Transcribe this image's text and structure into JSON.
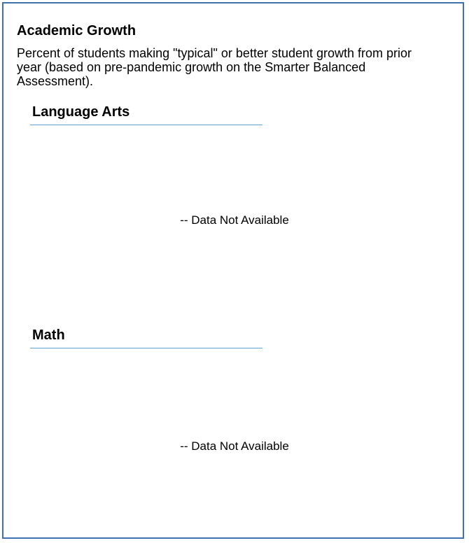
{
  "card": {
    "title": "Academic Growth",
    "description": "Percent of students making \"typical\" or better student growth from prior year (based on pre-pandemic growth on the Smarter Balanced Assessment)."
  },
  "sections": [
    {
      "heading": "Language Arts",
      "status": "-- Data Not Available"
    },
    {
      "heading": "Math",
      "status": "-- Data Not Available"
    }
  ],
  "colors": {
    "border": "#3f70b0",
    "rule": "#5ba3d8"
  }
}
